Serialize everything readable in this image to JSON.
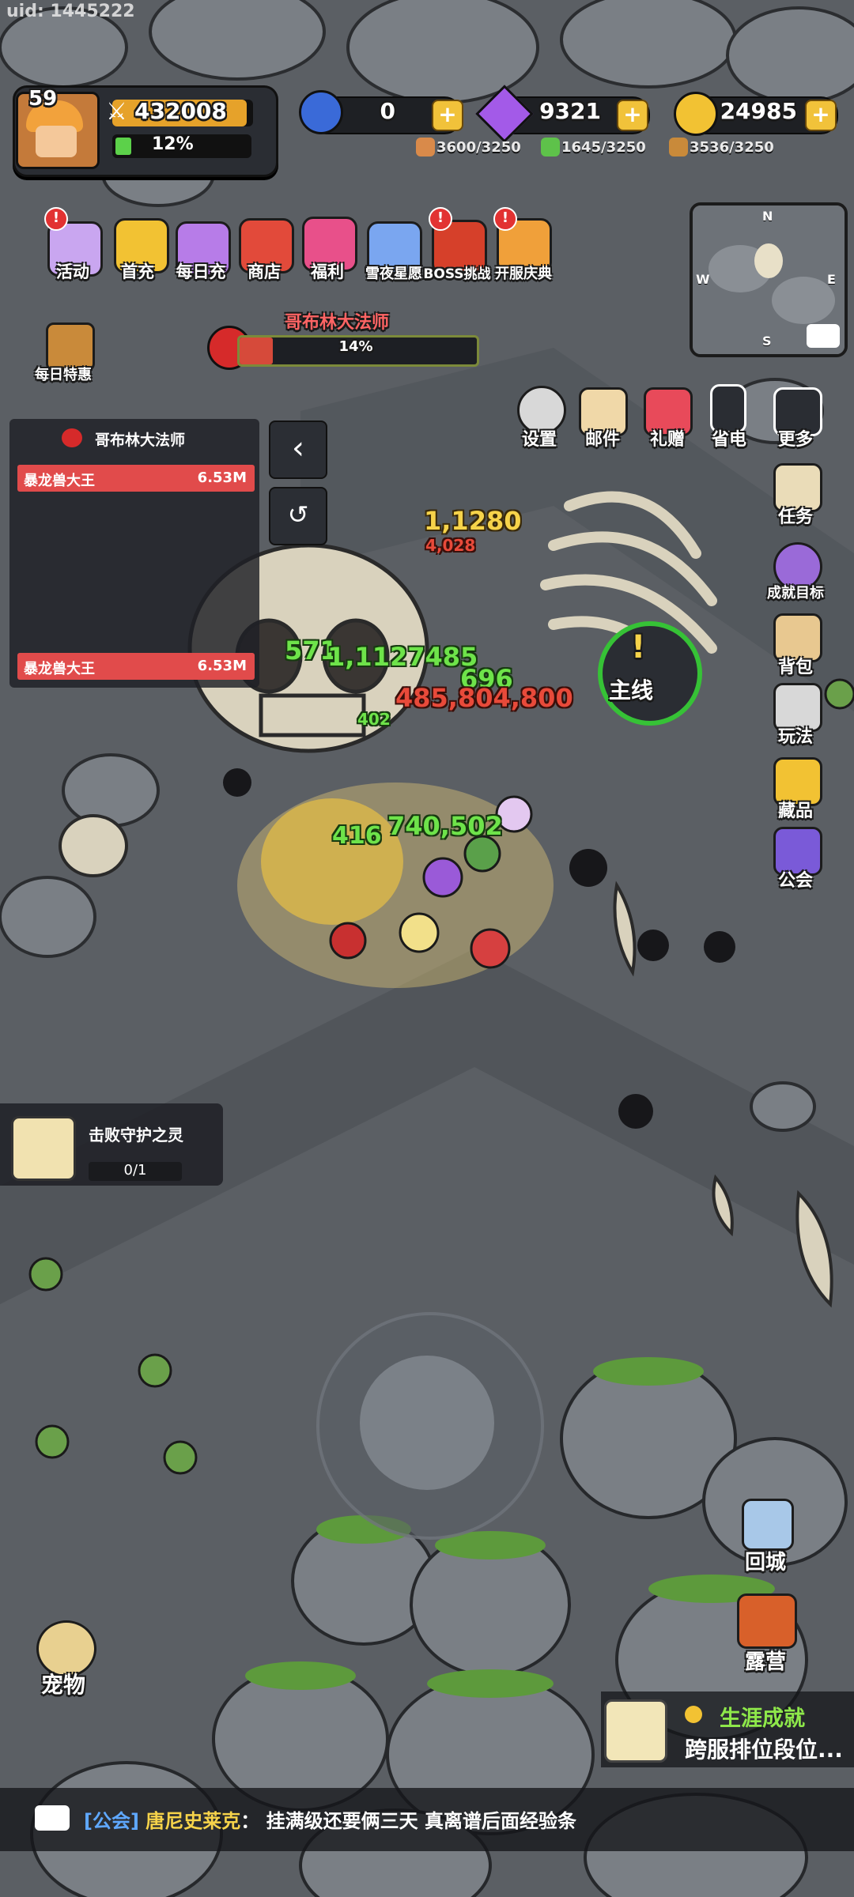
{
  "uid": "uid: 1445222",
  "player": {
    "level": "59",
    "power": "432008",
    "exp_percent": "12%"
  },
  "currencies": [
    {
      "name": "moon",
      "value": "0",
      "color": "#3a6ad8"
    },
    {
      "name": "gem",
      "value": "9321",
      "color": "#a35ae8"
    },
    {
      "name": "gold",
      "value": "24985",
      "color": "#f2c233"
    }
  ],
  "resources": [
    {
      "name": "meat",
      "value": "3600/3250"
    },
    {
      "name": "leaf",
      "value": "1645/3250"
    },
    {
      "name": "bread",
      "value": "3536/3250"
    }
  ],
  "top_menu": [
    {
      "label": "活动",
      "badge": "!"
    },
    {
      "label": "首充",
      "badge": ""
    },
    {
      "label": "每日充",
      "badge": ""
    },
    {
      "label": "商店",
      "badge": ""
    },
    {
      "label": "福利",
      "badge": ""
    },
    {
      "label": "雪夜星愿",
      "badge": ""
    },
    {
      "label": "BOSS挑战",
      "badge": "!"
    },
    {
      "label": "开服庆典",
      "badge": "!"
    }
  ],
  "daily_deal": "每日特惠",
  "minimap": {
    "n": "N",
    "e": "E",
    "s": "S",
    "w": "W"
  },
  "boss": {
    "name": "哥布林大法师",
    "hp_percent": "14%",
    "hp_fraction": 0.14
  },
  "rank_panel": {
    "title": "哥布林大法师",
    "rows": [
      {
        "name": "暴龙兽大王",
        "value": "6.53M"
      },
      {
        "name": "暴龙兽大王",
        "value": "6.53M"
      }
    ]
  },
  "quick_buttons": [
    {
      "label": "设置"
    },
    {
      "label": "邮件"
    },
    {
      "label": "礼赠"
    },
    {
      "label": "省电"
    },
    {
      "label": "更多"
    }
  ],
  "side_menu": [
    {
      "label": "任务"
    },
    {
      "label": "成就目标"
    },
    {
      "label": "背包"
    },
    {
      "label": "玩法"
    },
    {
      "label": "藏品"
    },
    {
      "label": "公会"
    }
  ],
  "main_quest": "主线",
  "floating_numbers": {
    "a": "1,1127485",
    "b": "696",
    "c": "485,804,800",
    "d": "740,502",
    "e": "416",
    "f": "4,028",
    "g": "402",
    "h": "571",
    "i": "1,1280"
  },
  "task": {
    "name": "击败守护之灵",
    "progress": "0/1"
  },
  "bottom_right": [
    {
      "label": "回城"
    },
    {
      "label": "露营"
    }
  ],
  "pet": "宠物",
  "achievement": {
    "title": "生涯成就",
    "subtitle": "跨服排位段位..."
  },
  "chat": {
    "channel": "[公会]",
    "user": "唐尼史莱克",
    "sep": "：",
    "message": "挂满级还要俩三天 真离谱后面经验条"
  }
}
